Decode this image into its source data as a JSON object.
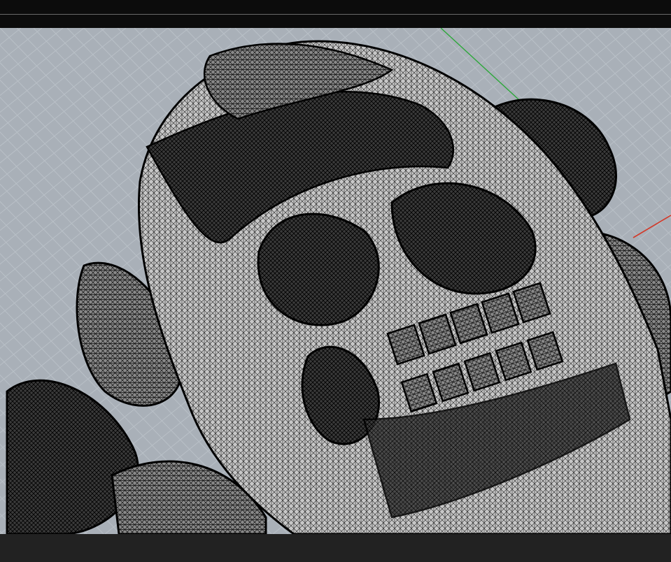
{
  "app": {
    "view": "perspective",
    "display_mode": "wireframe-mesh"
  },
  "viewport": {
    "background_color": "#a9b0b8",
    "grid_color": "#b9c0c7",
    "x_axis_color": "#d23a2a",
    "y_axis_color": "#2da83a",
    "model": "skull-with-roses-mesh"
  }
}
